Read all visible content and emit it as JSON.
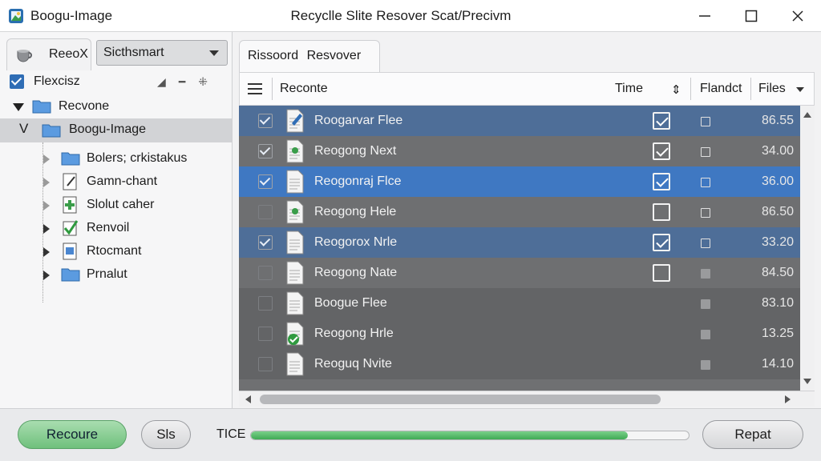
{
  "window": {
    "app_name": "Boogu-Image",
    "title": "Recyclle Slite Resover Scat/Precivm"
  },
  "left": {
    "tab_label": "ReeoX",
    "select_value": "Sicthsmart",
    "header_label": "Flexcisz",
    "tree": [
      {
        "label": "Recvone",
        "icon": "folder-icon"
      },
      {
        "label": "Boogu-Image",
        "icon": "folder-icon"
      },
      {
        "label": "Bolers; crkistakus",
        "icon": "folder-icon"
      },
      {
        "label": "Gamn-chant",
        "icon": "edit-doc-icon"
      },
      {
        "label": "Slolut caher",
        "icon": "green-plus-doc-icon"
      },
      {
        "label": "Renvoil",
        "icon": "green-check-icon"
      },
      {
        "label": "Rtocmant",
        "icon": "blue-doc-icon"
      },
      {
        "label": "Prnalut",
        "icon": "folder-icon"
      }
    ]
  },
  "right": {
    "tab_label": "Rissoord Resvover",
    "columns": {
      "name": "Reconte",
      "time": "Time",
      "flag": "Flandct",
      "files": "Files"
    },
    "rows": [
      {
        "name": "Roogarvar Flee",
        "checked": true,
        "time_checked": true,
        "value": "86.55",
        "style": "blue"
      },
      {
        "name": "Reogong Next",
        "checked": true,
        "time_checked": true,
        "value": "34.00",
        "style": "grey"
      },
      {
        "name": "Reogonraj Flce",
        "checked": true,
        "time_checked": true,
        "value": "36.00",
        "style": "bright"
      },
      {
        "name": "Reogong Hele",
        "checked": false,
        "time_checked": false,
        "value": "86.50",
        "style": "grey"
      },
      {
        "name": "Reogorox Nrle",
        "checked": true,
        "time_checked": true,
        "value": "33.20",
        "style": "blue"
      },
      {
        "name": "Reogong Nate",
        "checked": false,
        "time_checked": false,
        "value": "84.50",
        "style": "grey"
      },
      {
        "name": "Boogue Flee",
        "checked": false,
        "time_checked": null,
        "value": "83.10",
        "style": "dark"
      },
      {
        "name": "Reogong Hrle",
        "checked": false,
        "time_checked": null,
        "value": "13.25",
        "style": "dark"
      },
      {
        "name": "Reoguq Nvite",
        "checked": false,
        "time_checked": null,
        "value": "14.10",
        "style": "dark"
      }
    ]
  },
  "bottom": {
    "recover_label": "Recoure",
    "sis_label": "Sls",
    "progress_label": "TICE",
    "progress_fraction": 0.86,
    "repat_label": "Repat"
  }
}
